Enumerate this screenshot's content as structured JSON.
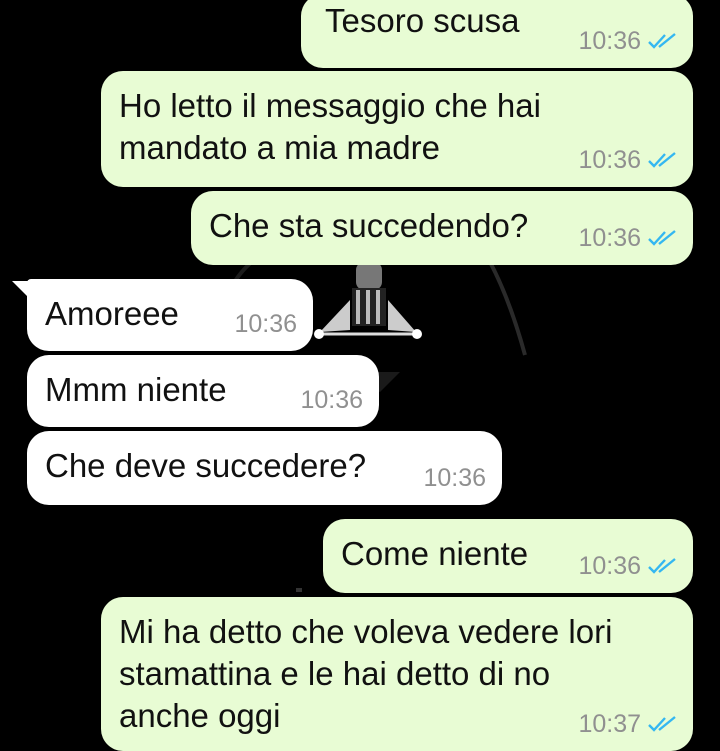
{
  "messages": [
    {
      "text": "Tesoro scusa",
      "time": "10:36",
      "direction": "outgoing",
      "read": true
    },
    {
      "text": "Ho letto il messaggio che hai\nmandato a mia madre",
      "time": "10:36",
      "direction": "outgoing",
      "read": true
    },
    {
      "text": "Che sta succedendo?",
      "time": "10:36",
      "direction": "outgoing",
      "read": true
    },
    {
      "text": "Amoreee",
      "time": "10:36",
      "direction": "incoming"
    },
    {
      "text": "Mmm niente",
      "time": "10:36",
      "direction": "incoming"
    },
    {
      "text": "Che deve succedere?",
      "time": "10:36",
      "direction": "incoming"
    },
    {
      "text": "Come niente",
      "time": "10:36",
      "direction": "outgoing",
      "read": true
    },
    {
      "text": "Mi ha detto che voleva vedere lori\nstamattina e le hai detto di no\nanche oggi",
      "time": "10:37",
      "direction": "outgoing",
      "read": true
    }
  ],
  "colors": {
    "background": "#000000",
    "outgoing_bubble": "#e8fcd4",
    "incoming_bubble": "#ffffff",
    "timestamp": "#909090",
    "read_ticks": "#34b7f1"
  },
  "icons": {
    "read_receipt": "double-check-icon"
  }
}
